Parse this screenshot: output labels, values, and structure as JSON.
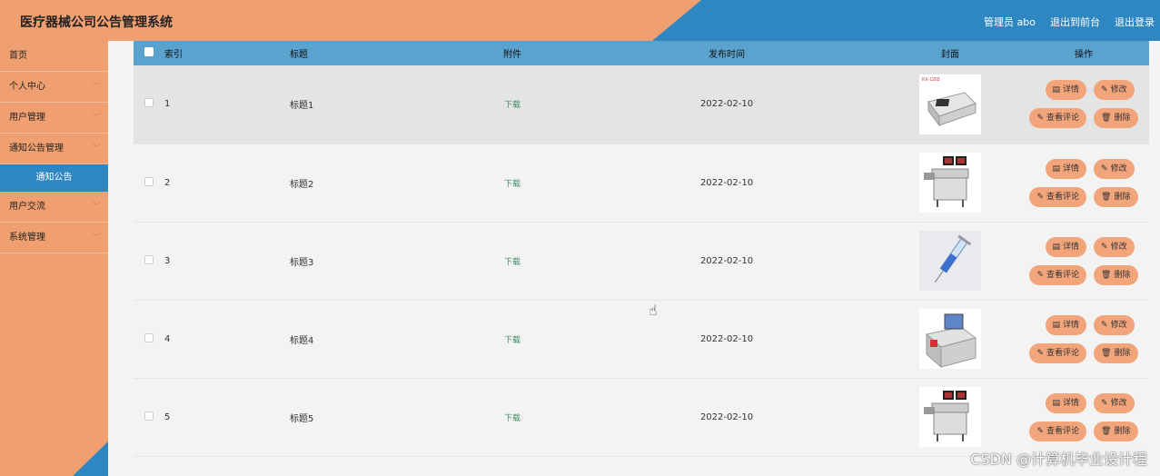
{
  "header": {
    "title": "医疗器械公司公告管理系统",
    "admin_label": "管理员 abo",
    "front_label": "退出到前台",
    "logout_label": "退出登录"
  },
  "sidebar": {
    "items": [
      {
        "label": "首页",
        "chevron": ""
      },
      {
        "label": "个人中心",
        "chevron": "﹀"
      },
      {
        "label": "用户管理",
        "chevron": "﹀"
      },
      {
        "label": "通知公告管理",
        "chevron": "﹀"
      },
      {
        "label": "通知公告",
        "chevron": ""
      },
      {
        "label": "用户交流",
        "chevron": "﹀"
      },
      {
        "label": "系统管理",
        "chevron": "﹀"
      }
    ]
  },
  "table": {
    "columns": [
      "索引",
      "标题",
      "附件",
      "发布时间",
      "封面",
      "操作"
    ],
    "rows": [
      {
        "index": "1",
        "title": "标题1",
        "attachment": "下载",
        "date": "2022-02-10",
        "cover": "ecg-device-icon"
      },
      {
        "index": "2",
        "title": "标题2",
        "attachment": "下载",
        "date": "2022-02-10",
        "cover": "medical-cart-icon"
      },
      {
        "index": "3",
        "title": "标题3",
        "attachment": "下载",
        "date": "2022-02-10",
        "cover": "syringe-icon"
      },
      {
        "index": "4",
        "title": "标题4",
        "attachment": "下载",
        "date": "2022-02-10",
        "cover": "monitor-device-icon"
      },
      {
        "index": "5",
        "title": "标题5",
        "attachment": "下载",
        "date": "2022-02-10",
        "cover": "medical-cart-icon"
      }
    ],
    "actions": {
      "detail": "详情",
      "edit": "修改",
      "comments": "查看评论",
      "delete": "删除"
    }
  },
  "watermark": "CSDN @计算机毕业设计程"
}
